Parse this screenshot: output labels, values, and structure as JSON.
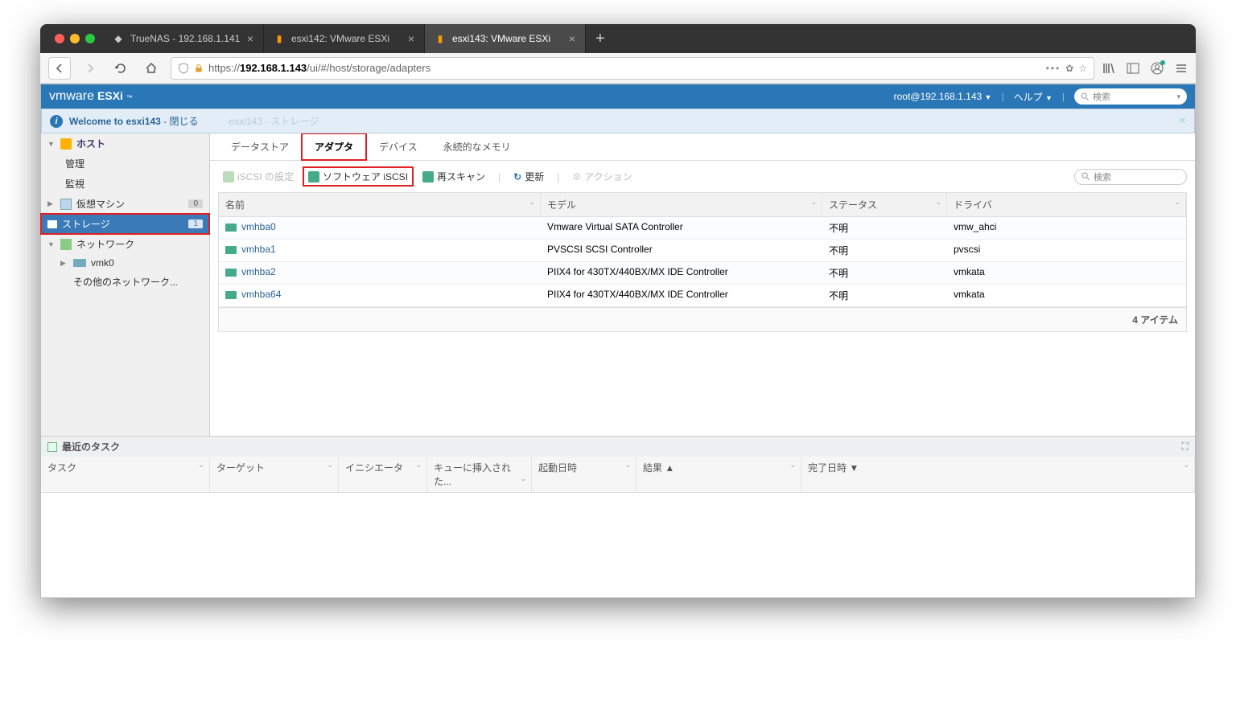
{
  "browser": {
    "tabs": [
      {
        "title": "TrueNAS - 192.168.1.141"
      },
      {
        "title": "esxi142: VMware ESXi"
      },
      {
        "title": "esxi143: VMware ESXi"
      }
    ],
    "url_prefix": "https://",
    "url_host": "192.168.1.143",
    "url_path": "/ui/#/host/storage/adapters"
  },
  "header": {
    "brand_vm": "vmware",
    "brand_prod": "ESXi",
    "user": "root@192.168.1.143",
    "help": "ヘルプ",
    "search_placeholder": "検索"
  },
  "welcome": {
    "text": "Welcome to esxi143",
    "close_word": "閉じる",
    "ghost": "esxi143 - ストレージ"
  },
  "nav": {
    "host": "ホスト",
    "host_manage": "管理",
    "host_monitor": "監視",
    "vm": "仮想マシン",
    "vm_badge": "0",
    "storage": "ストレージ",
    "storage_badge": "1",
    "network": "ネットワーク",
    "vmk0": "vmk0",
    "net_other": "その他のネットワーク..."
  },
  "tabs": {
    "datastore": "データストア",
    "adapter": "アダプタ",
    "device": "デバイス",
    "pmem": "永続的なメモリ"
  },
  "toolbar": {
    "iscsi_cfg": "iSCSI の設定",
    "sw_iscsi": "ソフトウェア iSCSI",
    "rescan": "再スキャン",
    "refresh": "更新",
    "action": "アクション",
    "search_placeholder": "検索"
  },
  "cols": {
    "name": "名前",
    "model": "モデル",
    "status": "ステータス",
    "driver": "ドライバ"
  },
  "rows": [
    {
      "name": "vmhba0",
      "model": "Vmware Virtual SATA Controller",
      "status": "不明",
      "driver": "vmw_ahci"
    },
    {
      "name": "vmhba1",
      "model": "PVSCSI SCSI Controller",
      "status": "不明",
      "driver": "pvscsi"
    },
    {
      "name": "vmhba2",
      "model": "PIIX4 for 430TX/440BX/MX IDE Controller",
      "status": "不明",
      "driver": "vmkata"
    },
    {
      "name": "vmhba64",
      "model": "PIIX4 for 430TX/440BX/MX IDE Controller",
      "status": "不明",
      "driver": "vmkata"
    }
  ],
  "footer_count": "4 アイテム",
  "tasks": {
    "title": "最近のタスク",
    "cols": {
      "task": "タスク",
      "target": "ターゲット",
      "initiator": "イニシエータ",
      "queued": "キューに挿入された...",
      "start": "起動日時",
      "result": "結果 ▲",
      "complete": "完了日時 ▼"
    }
  }
}
